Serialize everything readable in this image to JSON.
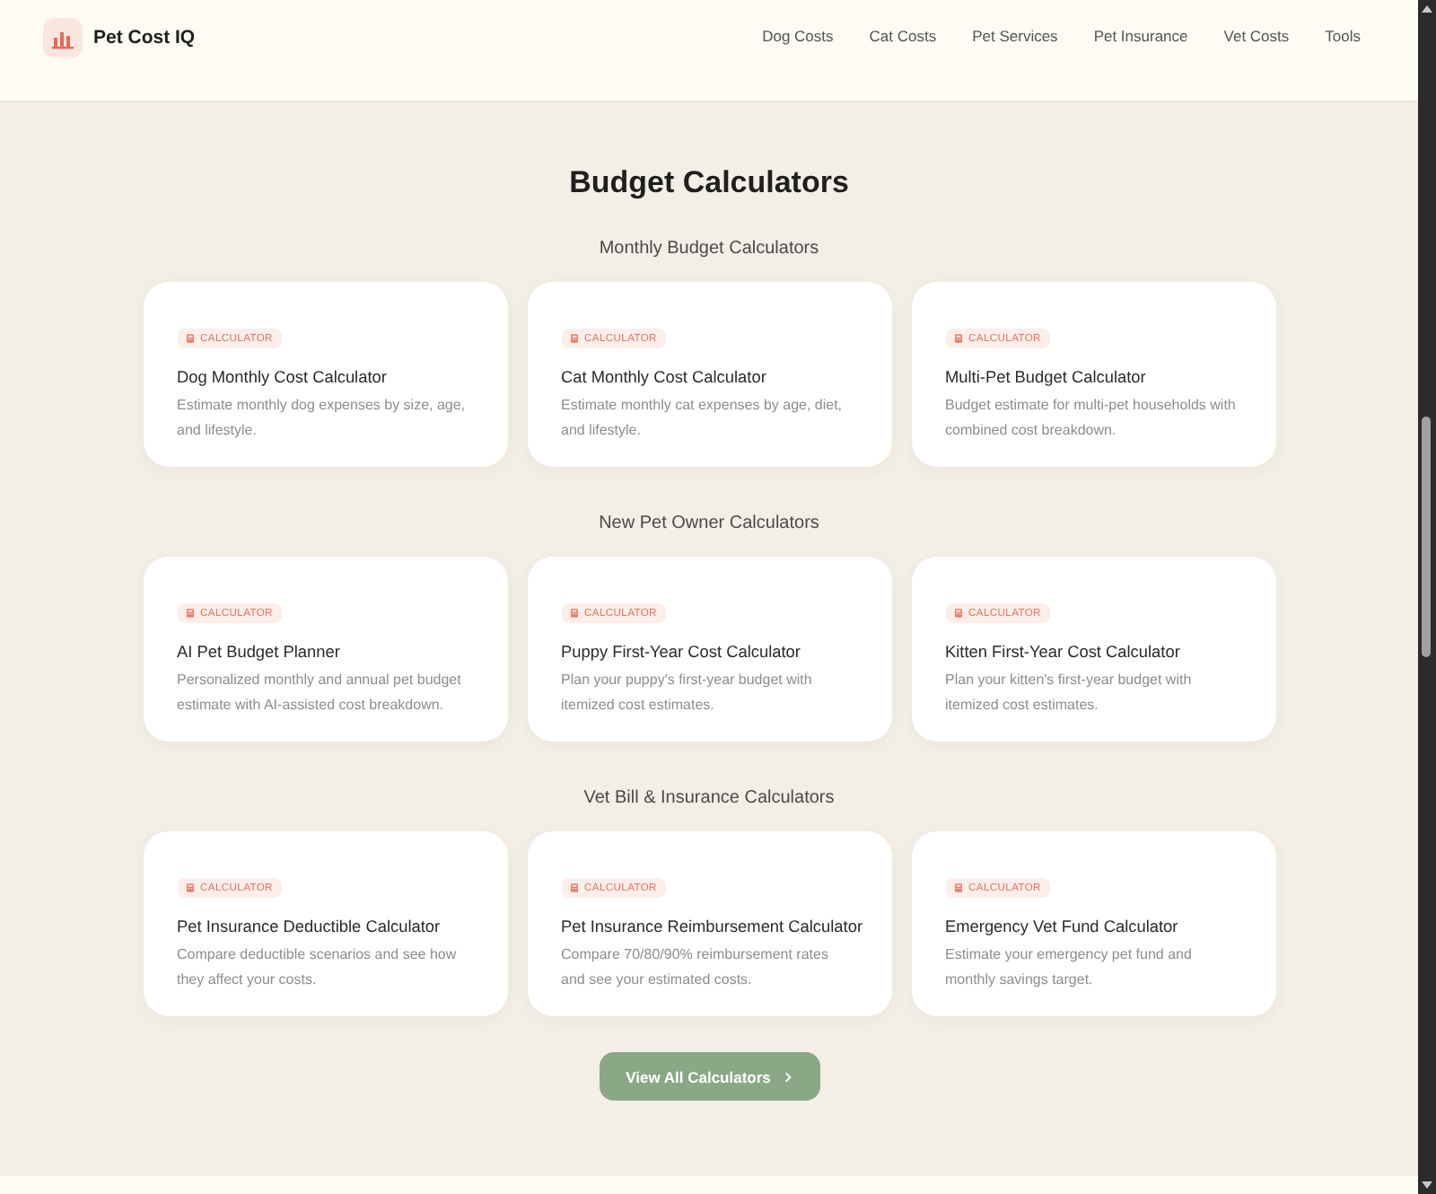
{
  "header": {
    "brand": "Pet Cost IQ",
    "nav": [
      {
        "label": "Dog Costs"
      },
      {
        "label": "Cat Costs"
      },
      {
        "label": "Pet Services"
      },
      {
        "label": "Pet Insurance"
      },
      {
        "label": "Vet Costs"
      },
      {
        "label": "Tools"
      }
    ]
  },
  "page_title": "Budget Calculators",
  "sections": [
    {
      "heading": "Monthly Budget Calculators",
      "cards": [
        {
          "badge": "CALCULATOR",
          "title": "Dog Monthly Cost Calculator",
          "description": "Estimate monthly dog expenses by size, age, and lifestyle."
        },
        {
          "badge": "CALCULATOR",
          "title": "Cat Monthly Cost Calculator",
          "description": "Estimate monthly cat expenses by age, diet, and lifestyle."
        },
        {
          "badge": "CALCULATOR",
          "title": "Multi-Pet Budget Calculator",
          "description": "Budget estimate for multi-pet households with combined cost breakdown."
        }
      ]
    },
    {
      "heading": "New Pet Owner Calculators",
      "cards": [
        {
          "badge": "CALCULATOR",
          "title": "AI Pet Budget Planner",
          "description": "Personalized monthly and annual pet budget estimate with AI-assisted cost breakdown."
        },
        {
          "badge": "CALCULATOR",
          "title": "Puppy First-Year Cost Calculator",
          "description": "Plan your puppy's first-year budget with itemized cost estimates."
        },
        {
          "badge": "CALCULATOR",
          "title": "Kitten First-Year Cost Calculator",
          "description": "Plan your kitten's first-year budget with itemized cost estimates."
        }
      ]
    },
    {
      "heading": "Vet Bill & Insurance Calculators",
      "cards": [
        {
          "badge": "CALCULATOR",
          "title": "Pet Insurance Deductible Calculator",
          "description": "Compare deductible scenarios and see how they affect your costs."
        },
        {
          "badge": "CALCULATOR",
          "title": "Pet Insurance Reimbursement Calculator",
          "description": "Compare 70/80/90% reimbursement rates and see your estimated costs."
        },
        {
          "badge": "CALCULATOR",
          "title": "Emergency Vet Fund Calculator",
          "description": "Estimate your emergency pet fund and monthly savings target."
        }
      ]
    }
  ],
  "cta_button": {
    "label": "View All Calculators"
  }
}
